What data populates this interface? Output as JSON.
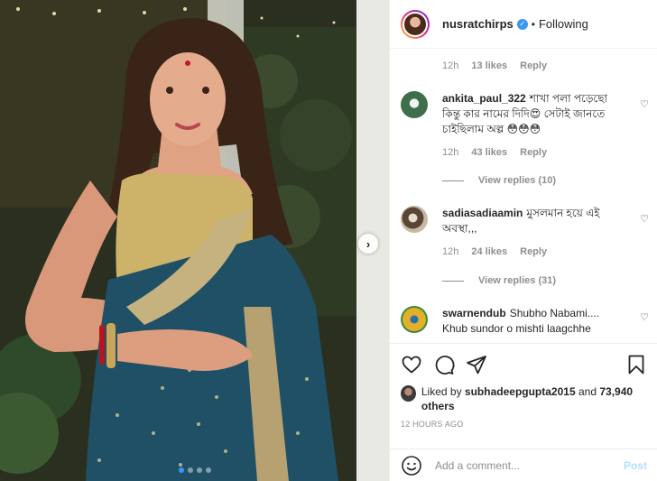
{
  "header": {
    "username": "nusratchirps",
    "separator": "•",
    "follow_status": "Following"
  },
  "comments": {
    "first_meta": {
      "time": "12h",
      "likes": "13 likes",
      "reply": "Reply"
    },
    "items": [
      {
        "username": "ankita_paul_322",
        "text": "শাখা পলা পড়েছো কিন্তু কার নামের দিদি😍 সেটাই জানতে চাইছিলাম অল্প 😳😳😳",
        "time": "12h",
        "likes": "43 likes",
        "reply": "Reply",
        "view_replies": "View replies (10)"
      },
      {
        "username": "sadiasadiaamin",
        "text": "মুসলমান হয়ে এই অবস্থা,,,",
        "time": "12h",
        "likes": "24 likes",
        "reply": "Reply",
        "view_replies": "View replies (31)"
      },
      {
        "username": "swarnendub",
        "text": "Shubho Nabami.... Khub sundor o mishti laagchhe",
        "time": "",
        "likes": "",
        "reply": ""
      }
    ]
  },
  "likes_summary": {
    "prefix": "Liked by",
    "user": "subhadeepgupta2015",
    "and": "and",
    "others": "73,940 others"
  },
  "timestamp": "12 HOURS AGO",
  "add_comment": {
    "placeholder": "Add a comment...",
    "post_label": "Post"
  },
  "carousel": {
    "total": 4,
    "active": 1
  },
  "colors": {
    "accent": "#3897f0",
    "muted": "#8e8e8e",
    "post_disabled": "#b2dffc"
  },
  "icons": [
    "heart-icon",
    "comment-icon",
    "share-icon",
    "bookmark-icon",
    "emoji-icon",
    "verified-badge-icon",
    "chevron-right-icon"
  ]
}
